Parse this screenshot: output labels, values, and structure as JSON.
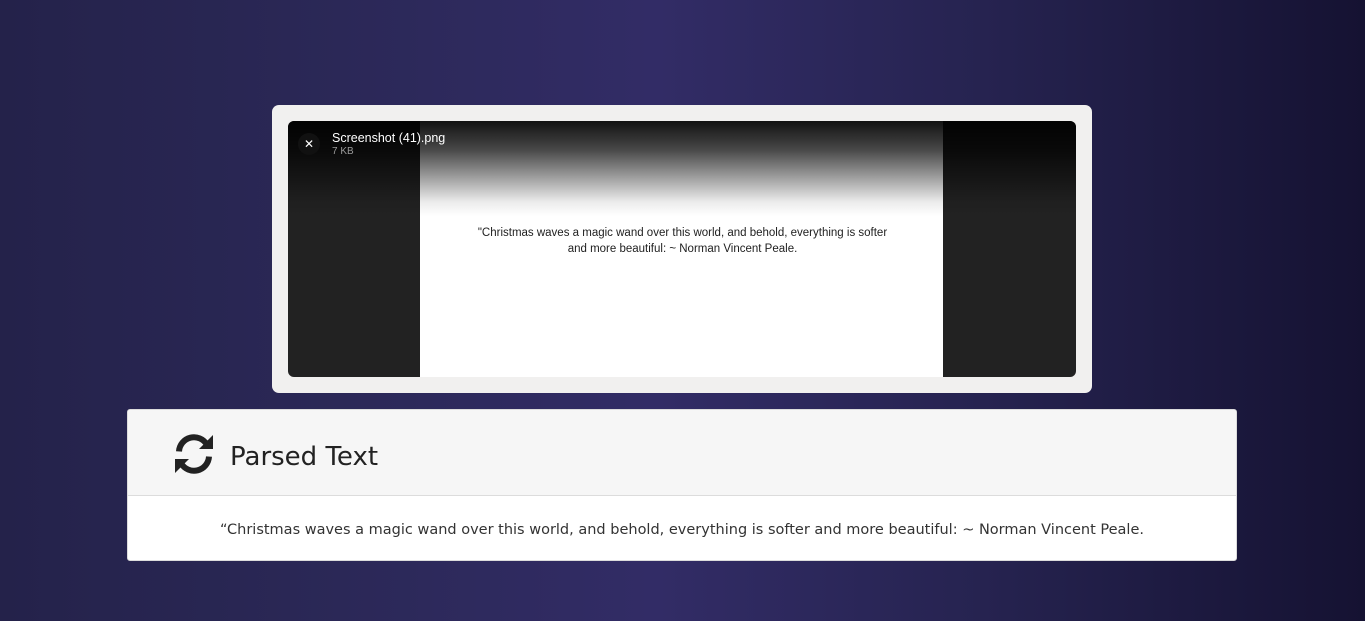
{
  "upload": {
    "file_name": "Screenshot (41).png",
    "file_size": "7 KB",
    "close_icon": "close-icon",
    "close_glyph": "✕",
    "image_text": "\"Christmas waves a magic wand over this world, and behold, everything is softer and more beautiful: ~ Norman Vincent Peale."
  },
  "parsed": {
    "icon": "sync-icon",
    "title": "Parsed Text",
    "text": "“Christmas waves a magic wand over this world, and behold, everything is softer and more beautiful: ~ Norman Vincent Peale."
  },
  "colors": {
    "background": "#2b2857",
    "card_background": "#f1f0ef",
    "preview_background": "#222222",
    "header_background": "#f6f6f6",
    "text": "#333333"
  }
}
